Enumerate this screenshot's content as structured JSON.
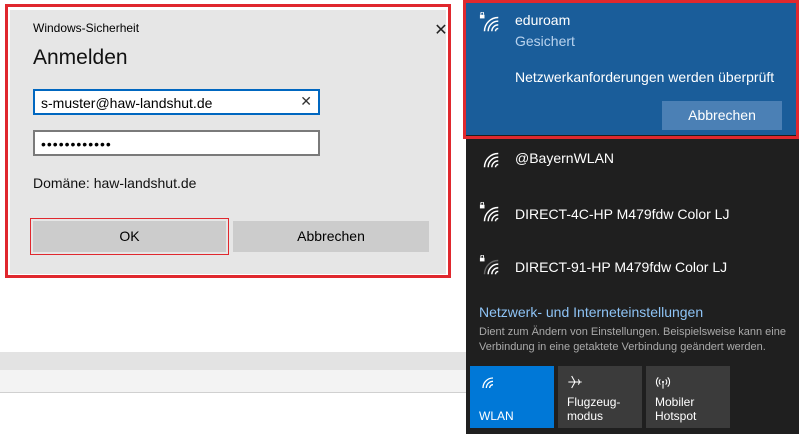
{
  "dialog": {
    "window_title": "Windows-Sicherheit",
    "heading": "Anmelden",
    "username_value": "s-muster@haw-landshut.de",
    "password_value": "••••••••••••",
    "domain_text": "Domäne: haw-landshut.de",
    "ok_label": "OK",
    "cancel_label": "Abbrechen"
  },
  "flyout": {
    "active_network": {
      "name": "eduroam",
      "state": "Gesichert",
      "status": "Netzwerkanforderungen werden überprüft",
      "cancel_label": "Abbrechen"
    },
    "networks": [
      {
        "name": "@BayernWLAN"
      },
      {
        "name": "DIRECT-4C-HP M479fdw Color LJ"
      },
      {
        "name": "DIRECT-91-HP M479fdw Color LJ"
      }
    ],
    "settings_link": "Netzwerk- und Interneteinstellungen",
    "settings_desc": "Dient zum Ändern von Einstellungen. Beispielsweise kann eine Verbindung in eine getaktete Verbindung geändert werden.",
    "tiles": [
      {
        "label": "WLAN",
        "icon": "wifi-icon",
        "active": true
      },
      {
        "label": "Flugzeug-\nmodus",
        "icon": "airplane-icon",
        "active": false
      },
      {
        "label": "Mobiler\nHotspot",
        "icon": "hotspot-icon",
        "active": false
      }
    ]
  },
  "colors": {
    "accent": "#1a5d9a",
    "highlight_outline": "#e0282e",
    "flyout_bg": "#1f1f1f",
    "tile_active": "#0078d7",
    "tile_inactive": "#3b3b3b"
  }
}
